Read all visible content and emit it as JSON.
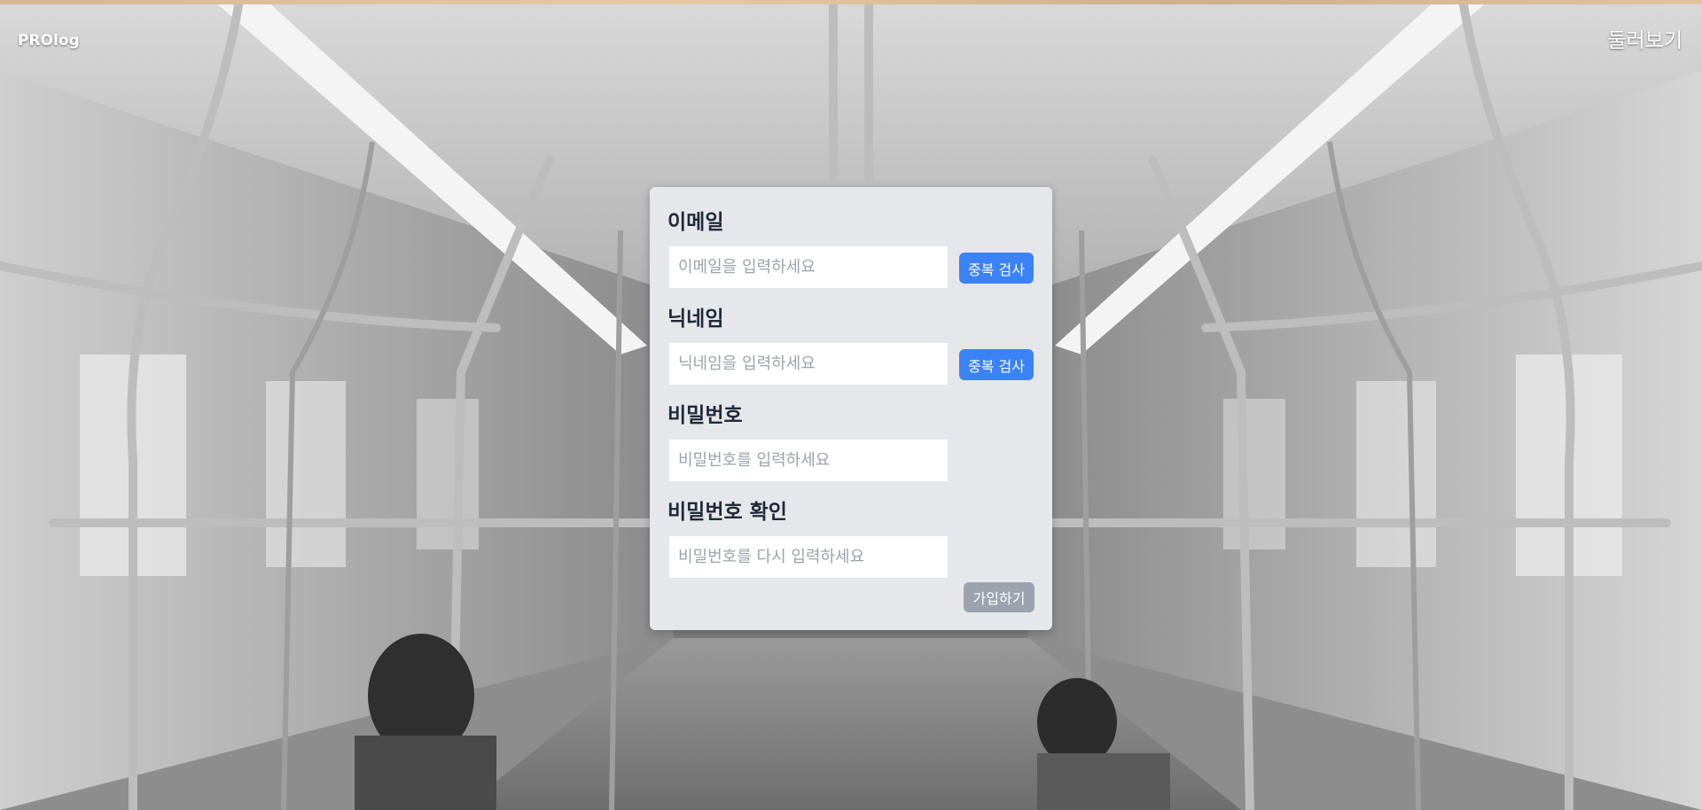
{
  "header": {
    "brand": "PROlog",
    "browse_label": "둘러보기"
  },
  "signup_form": {
    "email": {
      "label": "이메일",
      "placeholder": "이메일을 입력하세요",
      "value": "",
      "check_button": "중복 검사"
    },
    "nickname": {
      "label": "닉네임",
      "placeholder": "닉네임을 입력하세요",
      "value": "",
      "check_button": "중복 검사"
    },
    "password": {
      "label": "비밀번호",
      "placeholder": "비밀번호를 입력하세요",
      "value": ""
    },
    "password_confirm": {
      "label": "비밀번호 확인",
      "placeholder": "비밀번호를 다시 입력하세요",
      "value": ""
    },
    "submit_label": "가입하기"
  },
  "colors": {
    "card_background": "#e6e7ea",
    "check_button": "#3b82f6",
    "submit_button": "#9ca3af",
    "label_text": "#1f2937"
  },
  "background": {
    "icon": "subway-car-interior-photo"
  }
}
